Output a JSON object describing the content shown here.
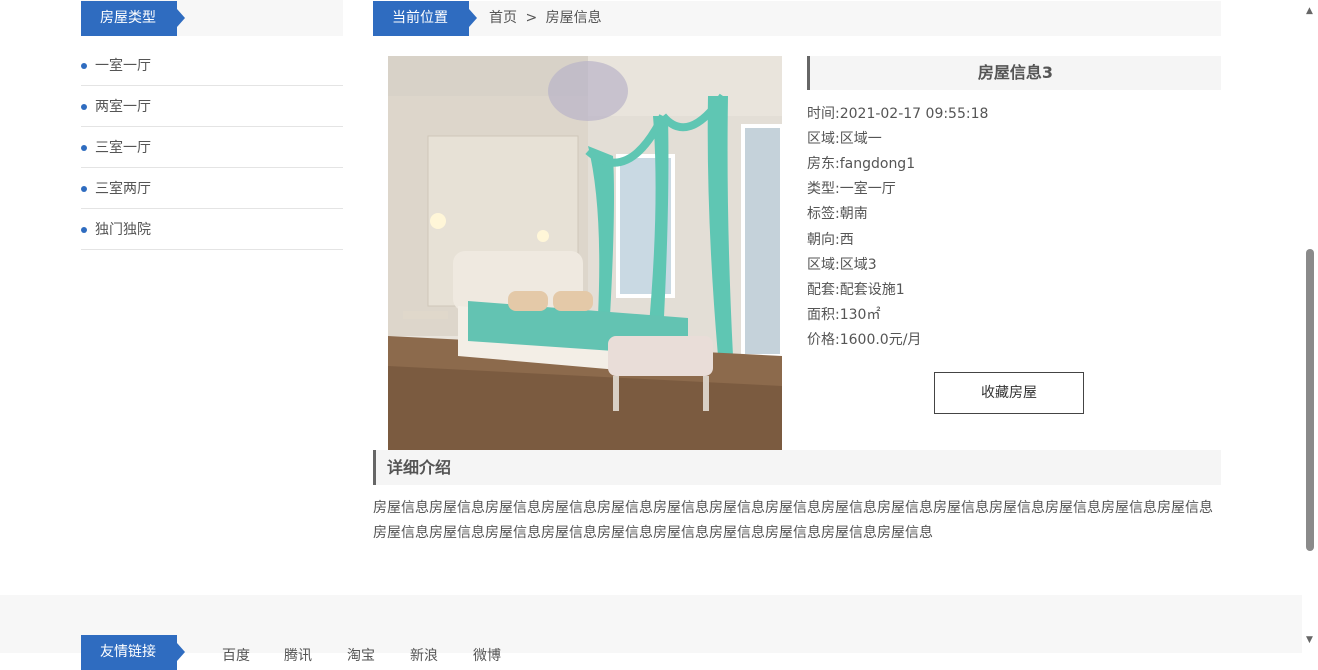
{
  "sidebar": {
    "title": "房屋类型",
    "items": [
      {
        "label": "一室一厅"
      },
      {
        "label": "两室一厅"
      },
      {
        "label": "三室一厅"
      },
      {
        "label": "三室两厅"
      },
      {
        "label": "独门独院"
      }
    ]
  },
  "breadcrumb": {
    "title": "当前位置",
    "home": "首页",
    "separator": ">",
    "current": "房屋信息"
  },
  "house": {
    "title": "房屋信息3",
    "fields": [
      {
        "label": "时间:",
        "value": "2021-02-17 09:55:18"
      },
      {
        "label": "区域:",
        "value": "区域一"
      },
      {
        "label": "房东:",
        "value": "fangdong1"
      },
      {
        "label": "类型:",
        "value": "一室一厅"
      },
      {
        "label": "标签:",
        "value": "朝南"
      },
      {
        "label": "朝向:",
        "value": "西"
      },
      {
        "label": "区域:",
        "value": "区域3"
      },
      {
        "label": "配套:",
        "value": "配套设施1"
      },
      {
        "label": "面积:",
        "value": "130㎡"
      },
      {
        "label": "价格:",
        "value": "1600.0元/月"
      }
    ],
    "favorite_button": "收藏房屋"
  },
  "detail": {
    "title": "详细介绍",
    "text": "房屋信息房屋信息房屋信息房屋信息房屋信息房屋信息房屋信息房屋信息房屋信息房屋信息房屋信息房屋信息房屋信息房屋信息房屋信息房屋信息房屋信息房屋信息房屋信息房屋信息房屋信息房屋信息房屋信息房屋信息房屋信息"
  },
  "footer": {
    "title": "友情链接",
    "links": [
      "百度",
      "腾讯",
      "淘宝",
      "新浪",
      "微博"
    ]
  },
  "colors": {
    "accent": "#2f6cc0",
    "teal": "#5fc6b3"
  },
  "icons": {
    "scroll_up": "▲",
    "scroll_down": "▼"
  }
}
